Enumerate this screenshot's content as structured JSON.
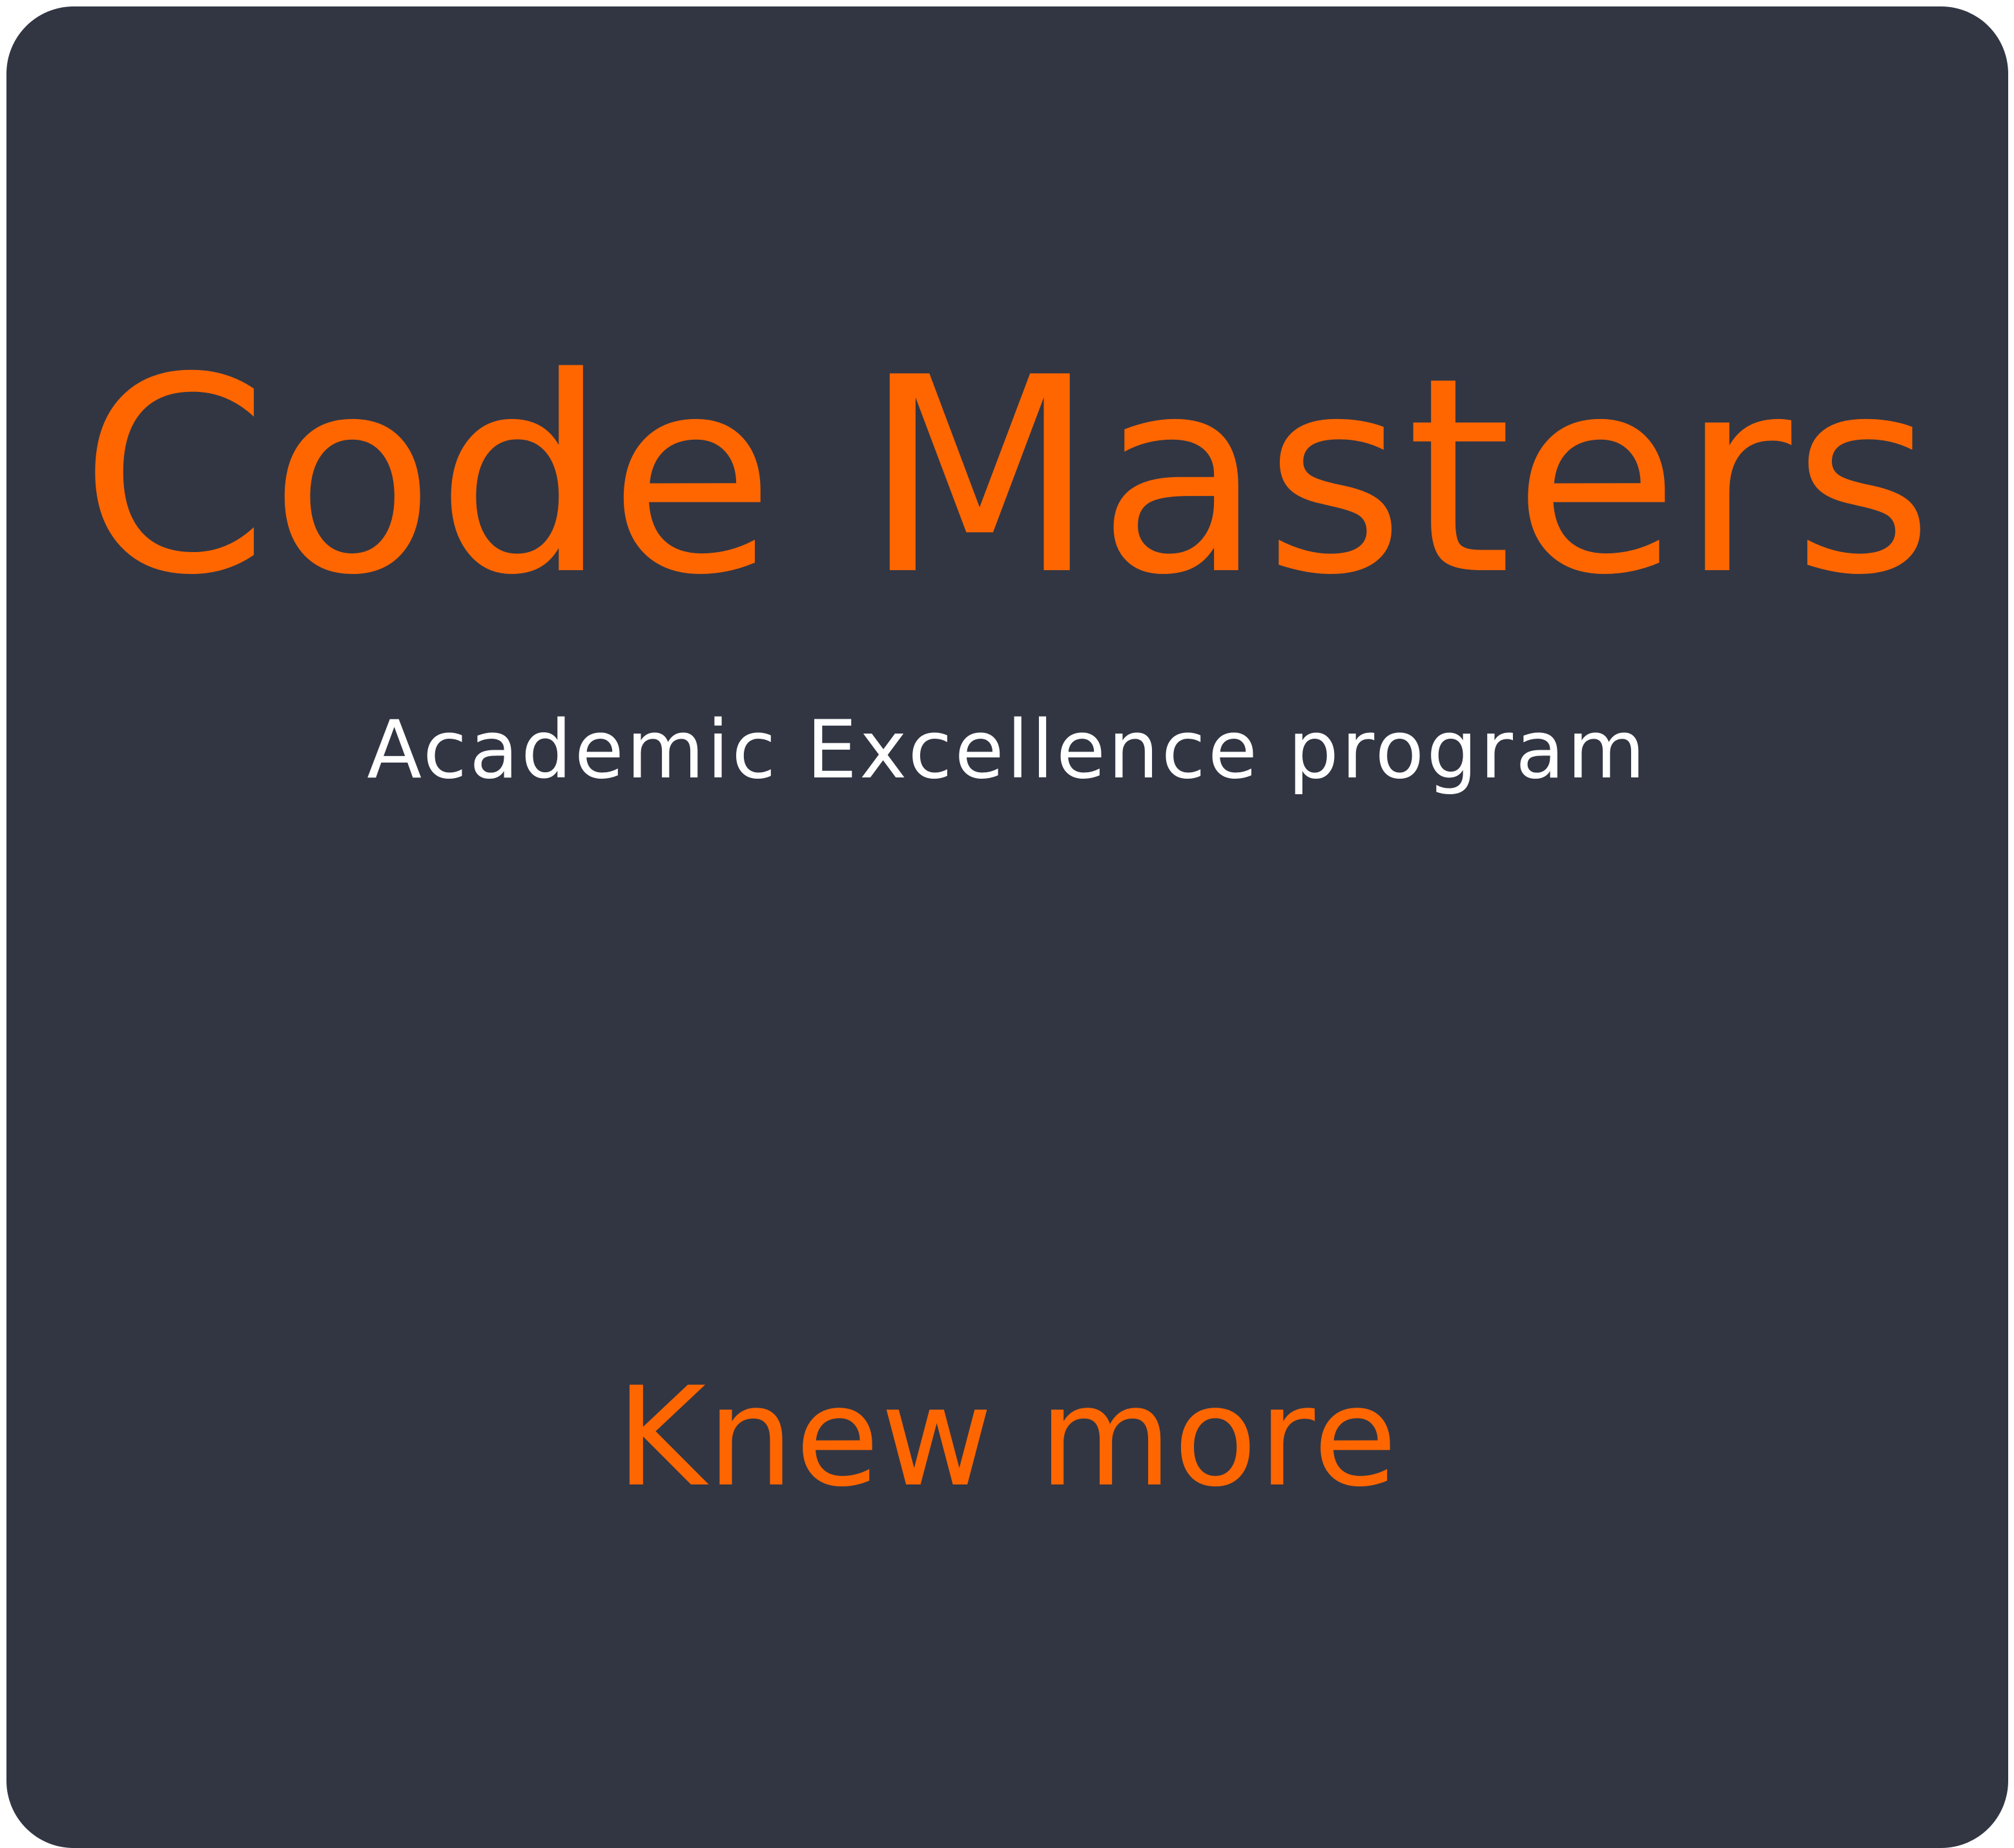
{
  "card": {
    "title": "Code Masters",
    "subtitle": "Academic Excellence program",
    "cta_label": "Knew more"
  },
  "colors": {
    "background": "#323643",
    "accent": "#ff6600",
    "subtitle_text": "#ffffff"
  }
}
